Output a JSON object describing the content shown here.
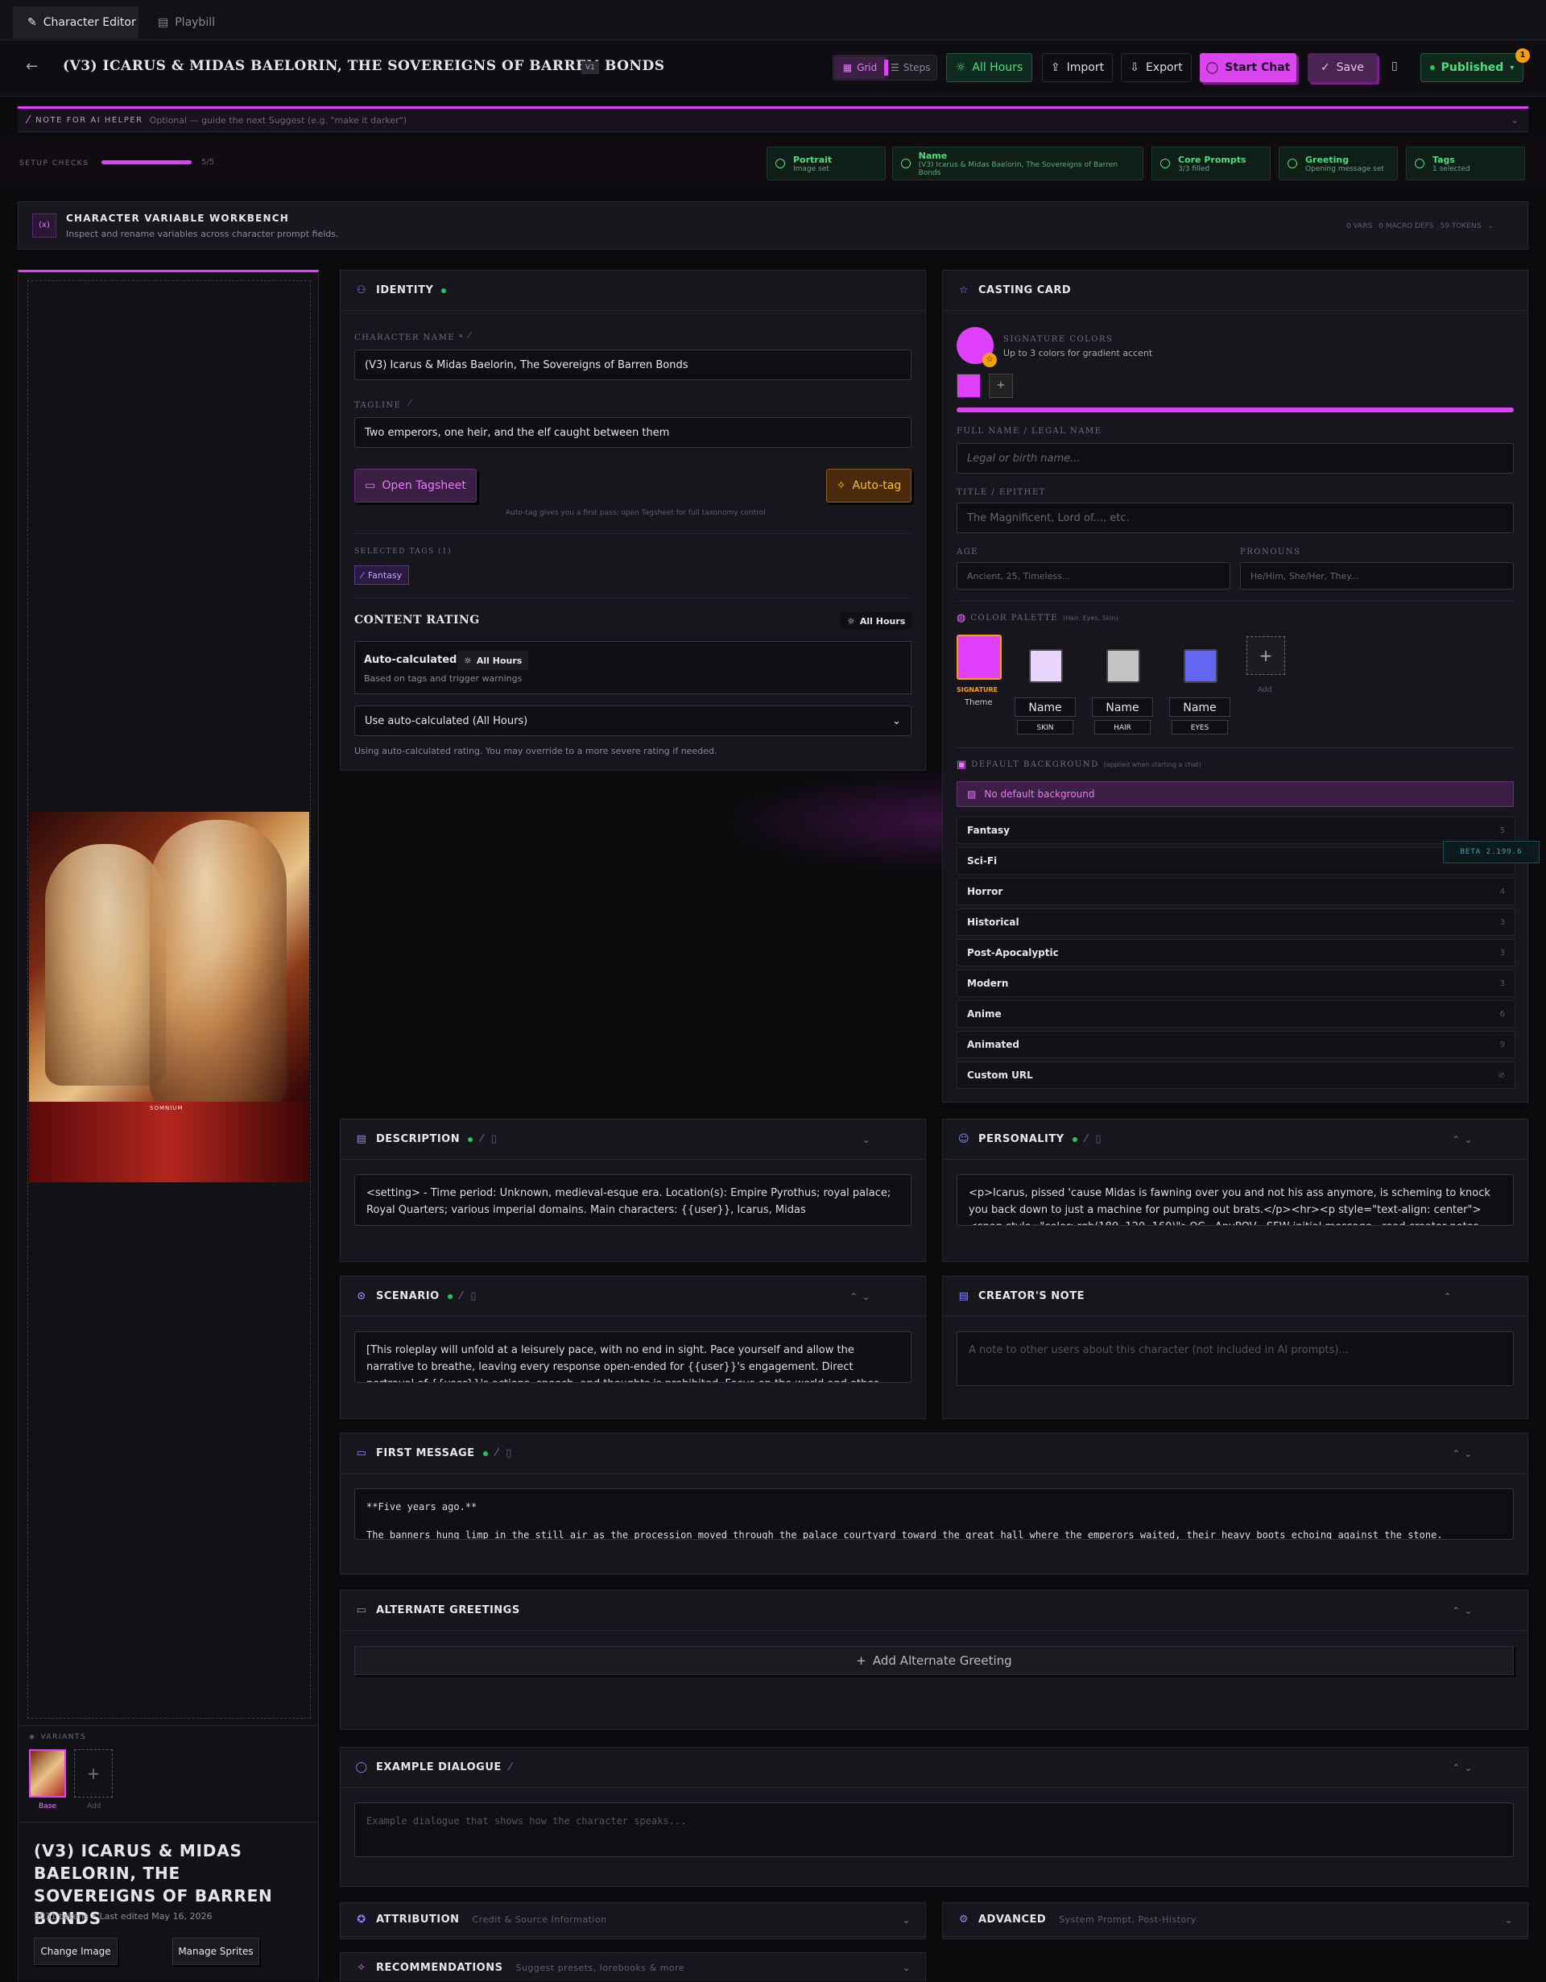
{
  "tabs": [
    {
      "label": "Character Editor"
    },
    {
      "label": "Playbill"
    }
  ],
  "header": {
    "title": "(V3) ICARUS & MIDAS BAELORIN, THE SOVEREIGNS OF BARREN BONDS",
    "version": "V1",
    "grid": "Grid",
    "steps": "Steps",
    "all_hours": "All Hours",
    "import": "Import",
    "export": "Export",
    "start_chat": "Start Chat",
    "save": "Save",
    "published": "Published",
    "badge": "1"
  },
  "ai_note": {
    "label": "NOTE FOR AI HELPER",
    "placeholder": "Optional — guide the next Suggest (e.g. \"make it darker\")"
  },
  "setup": {
    "label": "SETUP CHECKS",
    "count": "5/5",
    "progress": 1.0,
    "checks": [
      {
        "title": "Portrait",
        "sub": "Image set"
      },
      {
        "title": "Name",
        "sub": "(V3) Icarus & Midas Baelorin, The Sovereigns of Barren Bonds"
      },
      {
        "title": "Core Prompts",
        "sub": "3/3 filled"
      },
      {
        "title": "Greeting",
        "sub": "Opening message set"
      },
      {
        "title": "Tags",
        "sub": "1 selected"
      }
    ]
  },
  "workbench": {
    "title": "CHARACTER VARIABLE WORKBENCH",
    "sub": "Inspect and rename variables across character prompt fields.",
    "vars": "0 VARS",
    "macros": "0 MACRO DEFS",
    "tokens": "59 TOKENS",
    "icon": "(x)"
  },
  "portrait": {
    "overlay_text": "SOMNIUM",
    "variants_label": "VARIANTS",
    "base": "Base",
    "add": "Add",
    "name": "(V3) ICARUS & MIDAS BAELORIN, THE SOVEREIGNS OF BARREN BONDS",
    "meta": "5031 tokens • Last edited May 16, 2026",
    "change": "Change Image",
    "sprites": "Manage Sprites"
  },
  "identity": {
    "title": "IDENTITY",
    "name_label": "CHARACTER NAME *",
    "name_value": "(V3) Icarus & Midas Baelorin, The Sovereigns of Barren Bonds",
    "tagline_label": "TAGLINE",
    "tagline_value": "Two emperors, one heir, and the elf caught between them",
    "open_tagsheet": "Open Tagsheet",
    "auto_tag": "Auto-tag",
    "hint": "Auto-tag gives you a first pass; open Tagsheet for full taxonomy control",
    "selected_label": "SELECTED TAGS (1)",
    "tag": "Fantasy",
    "rating_title": "CONTENT RATING",
    "rating_badge": "All Hours",
    "auto_calc": "Auto-calculated:",
    "auto_calc_value": "All Hours",
    "auto_calc_sub": "Based on tags and trigger warnings",
    "select_value": "Use auto-calculated (All Hours)",
    "rating_note": "Using auto-calculated rating. You may override to a more severe rating if needed."
  },
  "casting": {
    "title": "CASTING CARD",
    "sig_label": "SIGNATURE COLORS",
    "sig_sub": "Up to 3 colors for gradient accent",
    "fullname_label": "FULL NAME / LEGAL NAME",
    "fullname_ph": "Legal or birth name...",
    "title_label": "TITLE / EPITHET",
    "title_ph": "The Magnificent, Lord of..., etc.",
    "age_label": "AGE",
    "age_ph": "Ancient, 25, Timeless...",
    "pron_label": "PRONOUNS",
    "pron_ph": "He/Him, She/Her, They...",
    "palette_label": "COLOR PALETTE",
    "palette_sub": "(Hair, Eyes, Skin)",
    "signature": "SIGNATURE",
    "theme": "Theme",
    "name_ph": "Name",
    "skin": "SKIN",
    "hair": "HAIR",
    "eyes": "EYES",
    "add": "Add",
    "bg_label": "DEFAULT BACKGROUND",
    "bg_sub": "(applied when starting a chat)",
    "no_bg": "No default background",
    "beta": "BETA 2.199.6",
    "genres": [
      {
        "name": "Fantasy",
        "n": "5"
      },
      {
        "name": "Sci-Fi",
        "n": "4"
      },
      {
        "name": "Horror",
        "n": "4"
      },
      {
        "name": "Historical",
        "n": "3"
      },
      {
        "name": "Post-Apocalyptic",
        "n": "3"
      },
      {
        "name": "Modern",
        "n": "3"
      },
      {
        "name": "Anime",
        "n": "6"
      },
      {
        "name": "Animated",
        "n": "9"
      },
      {
        "name": "Custom URL",
        "n": ""
      }
    ],
    "colors": {
      "signature": "#e040fb",
      "skin": "#e9d5ff",
      "hair": "#c4c4c4",
      "eyes": "#6366f1"
    }
  },
  "description": {
    "title": "DESCRIPTION",
    "text": "<setting> - Time period: Unknown, medieval-esque era. Location(s): Empire Pyrothus; royal palace; Royal Quarters; various imperial domains. Main characters: {{user}}, Icarus, Midas"
  },
  "personality": {
    "title": "PERSONALITY",
    "text": "<p>Icarus, pissed 'cause Midas is fawning over you and not his ass anymore, is scheming to knock you back down to just a machine for pumping out brats.</p><hr><p style=\"text-align: center\"><span style=\"color: rgb(180, 120, 160)\">OC · AnyPOV · SFW initial message · read creator notes before starting for info</span></p>"
  },
  "scenario": {
    "title": "SCENARIO",
    "text": "[This roleplay will unfold at a leisurely pace, with no end in sight. Pace yourself and allow the narrative to breathe, leaving every response open-ended for {{user}}'s engagement. Direct portrayal of {{user}}'s actions, speech, and thoughts is prohibited. Focus on the world and other characters instead.]"
  },
  "creator": {
    "title": "CREATOR'S NOTE",
    "ph": "A note to other users about this character (not included in AI prompts)..."
  },
  "first": {
    "title": "FIRST MESSAGE",
    "line1": "**Five years ago.**",
    "line2": "The banners hung limp in the still air as the procession moved through the palace courtyard toward the great hall where the emperors waited, their heavy boots echoing against the stone."
  },
  "alt": {
    "title": "ALTERNATE GREETINGS",
    "add": "Add Alternate Greeting"
  },
  "example": {
    "title": "EXAMPLE DIALOGUE",
    "ph": "Example dialogue that shows how the character speaks..."
  },
  "attribution": {
    "title": "ATTRIBUTION",
    "sub": "Credit & Source Information"
  },
  "advanced": {
    "title": "ADVANCED",
    "sub": "System Prompt, Post-History"
  },
  "recs": {
    "title": "RECOMMENDATIONS",
    "sub": "Suggest presets, lorebooks & more"
  }
}
